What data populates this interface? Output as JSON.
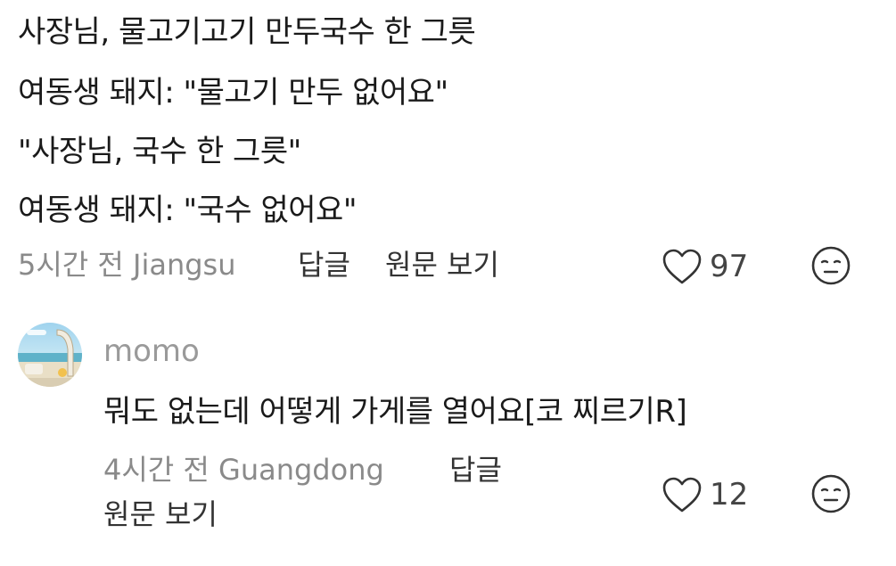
{
  "comment": {
    "lines": [
      "사장님, 물고기고기 만두국수 한 그릇",
      "여동생 돼지: \"물고기 만두 없어요\"",
      "\"사장님, 국수 한 그릇\"",
      "여동생 돼지: \"국수 없어요\""
    ],
    "time_location": "5시간 전 Jiangsu",
    "reply_label": "답글",
    "view_original_label": "원문 보기",
    "like_count": "97",
    "like_icon": "heart-outline-icon",
    "emoji_icon": "neutral-face-icon"
  },
  "reply": {
    "username": "momo",
    "text": "뭐도 없는데 어떻게 가게를 열어요[코 찌르기R]",
    "time_location": "4시간 전 Guangdong",
    "reply_label": "답글",
    "view_original_label": "원문 보기",
    "like_count": "12",
    "like_icon": "heart-outline-icon",
    "emoji_icon": "neutral-face-icon",
    "avatar_icon": "user-avatar-icon"
  },
  "colors": {
    "text_primary": "#1a1a1a",
    "text_secondary": "#8a8a8a",
    "icon": "#333333"
  }
}
